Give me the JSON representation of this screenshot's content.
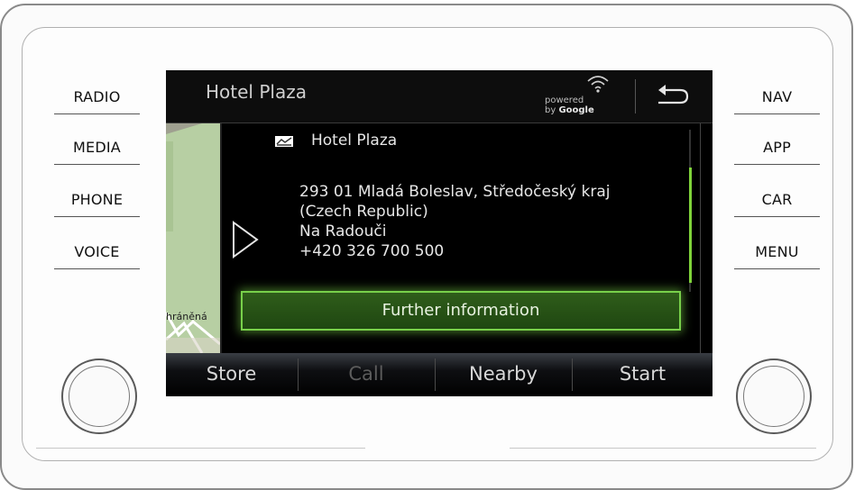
{
  "left_buttons": [
    "RADIO",
    "MEDIA",
    "PHONE",
    "VOICE"
  ],
  "right_buttons": [
    "NAV",
    "APP",
    "CAR",
    "MENU"
  ],
  "screen": {
    "title": "Hotel Plaza",
    "powered_by": "powered",
    "by_google_prefix": "by ",
    "google": "Google",
    "icons": {
      "signal": "wifi-icon",
      "back": "back-arrow-icon",
      "poi": "hotel-icon",
      "expand": "play-arrow-icon"
    },
    "poi_name": "Hotel Plaza",
    "address_lines": [
      "293 01 Mladá Boleslav, Středočeský kraj",
      "(Czech Republic)",
      "Na Radouči",
      "+420 326 700 500"
    ],
    "map_label": "hráněná",
    "further_info": "Further information",
    "bottom_buttons": [
      {
        "label": "Store",
        "enabled": true
      },
      {
        "label": "Call",
        "enabled": false
      },
      {
        "label": "Nearby",
        "enabled": true
      },
      {
        "label": "Start",
        "enabled": true
      }
    ],
    "colors": {
      "accent_green": "#78d04a",
      "map_green": "#b7cfa3"
    }
  }
}
